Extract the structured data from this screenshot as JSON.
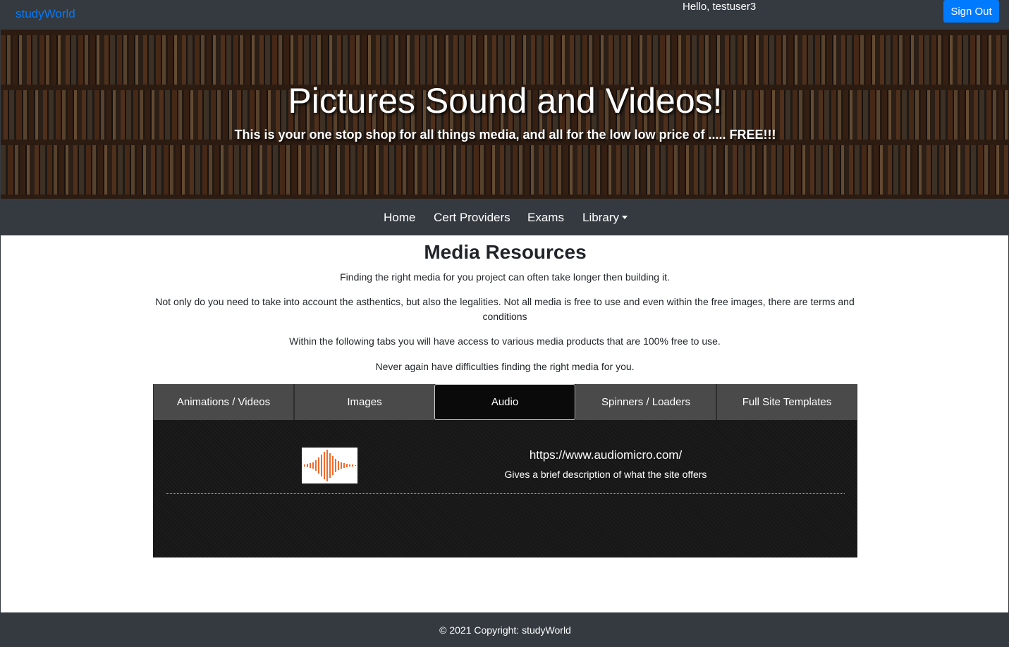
{
  "header": {
    "brand": "studyWorld",
    "greeting": "Hello, testuser3",
    "signout_label": "Sign Out"
  },
  "hero": {
    "title": "Pictures Sound and Videos!",
    "subtitle": "This is your one stop shop for all things media, and all for the low low price of ..... FREE!!!"
  },
  "nav": {
    "items": [
      {
        "label": "Home"
      },
      {
        "label": "Cert Providers"
      },
      {
        "label": "Exams"
      },
      {
        "label": "Library"
      }
    ]
  },
  "main": {
    "heading": "Media Resources",
    "paragraphs": [
      "Finding the right media for you project can often take longer then building it.",
      "Not only do you need to take into account the asthentics, but also the legalities. Not all media is free to use and even within the free images, there are terms and conditions",
      "Within the following tabs you will have access to various media products that are 100% free to use.",
      "Never again have difficulties finding the right media for you."
    ],
    "tabs": [
      {
        "label": "Animations / Videos",
        "active": false
      },
      {
        "label": "Images",
        "active": false
      },
      {
        "label": "Audio",
        "active": true
      },
      {
        "label": "Spinners / Loaders",
        "active": false
      },
      {
        "label": "Full Site Templates",
        "active": false
      }
    ],
    "panel": {
      "logo_icon": "audio-waveform-icon",
      "link": "https://www.audiomicro.com/",
      "description": "Gives a brief description of what the site offers"
    }
  },
  "footer": {
    "copyright": "© 2021 Copyright: studyWorld"
  },
  "colors": {
    "brand": "#007bff",
    "navbar": "#343a40",
    "waveform": "#f26b2e"
  }
}
